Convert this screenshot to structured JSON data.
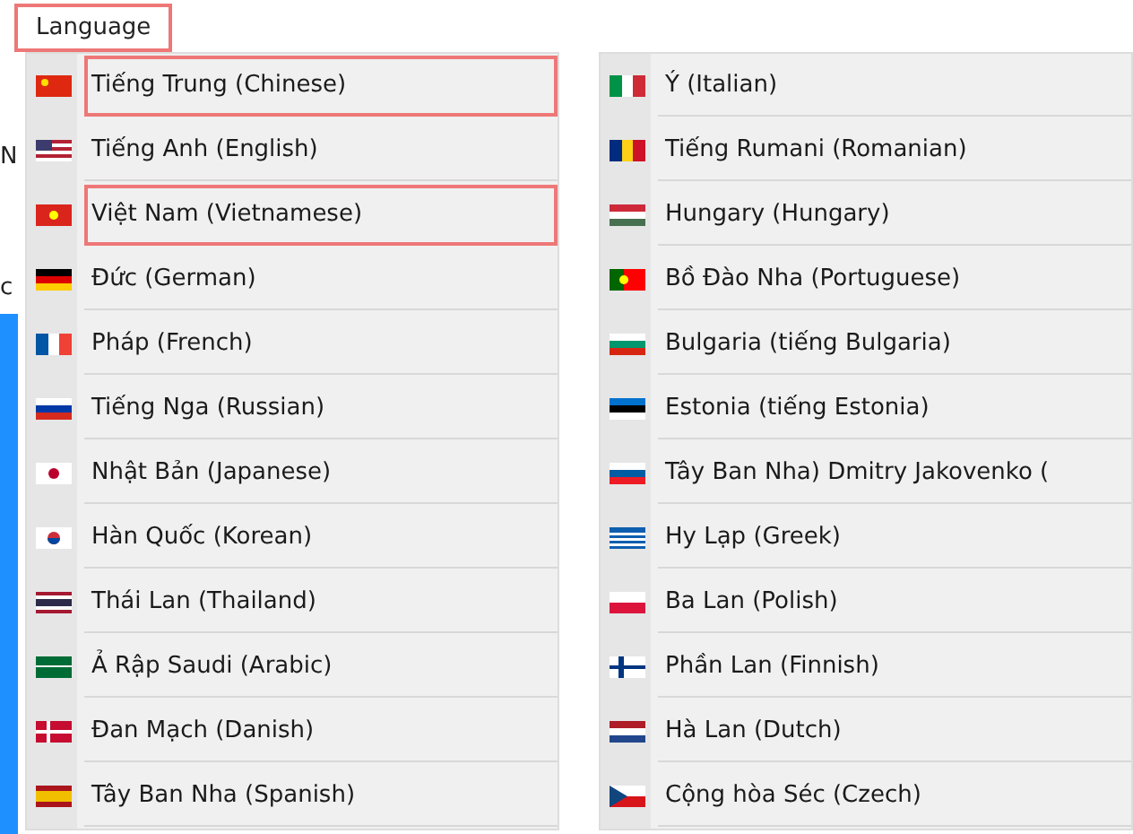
{
  "menu_title": "Language",
  "background_fragments": [
    "N",
    "c"
  ],
  "columns": [
    [
      {
        "label": "Tiếng Trung (Chinese)",
        "kind": "cn",
        "highlighted": true
      },
      {
        "label": "Tiếng Anh (English)",
        "kind": "us",
        "highlighted": false
      },
      {
        "label": "Việt Nam (Vietnamese)",
        "kind": "vn",
        "highlighted": true
      },
      {
        "label": "Đức (German)",
        "kind": "de",
        "highlighted": false
      },
      {
        "label": "Pháp (French)",
        "kind": "fr",
        "highlighted": false
      },
      {
        "label": "Tiếng Nga (Russian)",
        "kind": "ru",
        "highlighted": false
      },
      {
        "label": "Nhật Bản (Japanese)",
        "kind": "jp",
        "highlighted": false
      },
      {
        "label": "Hàn Quốc (Korean)",
        "kind": "kr",
        "highlighted": false
      },
      {
        "label": "Thái Lan (Thailand)",
        "kind": "th",
        "highlighted": false
      },
      {
        "label": "Ả Rập Saudi (Arabic)",
        "kind": "sa",
        "highlighted": false
      },
      {
        "label": "Đan Mạch (Danish)",
        "kind": "dk",
        "highlighted": false
      },
      {
        "label": "Tây Ban Nha (Spanish)",
        "kind": "es",
        "highlighted": false
      }
    ],
    [
      {
        "label": "Ý (Italian)",
        "kind": "it",
        "highlighted": false
      },
      {
        "label": "Tiếng Rumani (Romanian)",
        "kind": "ro",
        "highlighted": false
      },
      {
        "label": "Hungary (Hungary)",
        "kind": "hu",
        "highlighted": false
      },
      {
        "label": "Bồ Đào Nha (Portuguese)",
        "kind": "pt",
        "highlighted": false
      },
      {
        "label": "Bulgaria (tiếng Bulgaria)",
        "kind": "bg",
        "highlighted": false
      },
      {
        "label": "Estonia (tiếng Estonia)",
        "kind": "ee",
        "highlighted": false
      },
      {
        "label": "Tây Ban Nha) Dmitry Jakovenko (",
        "kind": "si",
        "highlighted": false
      },
      {
        "label": "Hy Lạp (Greek)",
        "kind": "gr",
        "highlighted": false
      },
      {
        "label": "Ba Lan (Polish)",
        "kind": "pl",
        "highlighted": false
      },
      {
        "label": "Phần Lan (Finnish)",
        "kind": "fi",
        "highlighted": false
      },
      {
        "label": "Hà Lan (Dutch)",
        "kind": "nl",
        "highlighted": false
      },
      {
        "label": "Cộng hòa Séc (Czech)",
        "kind": "cz",
        "highlighted": false
      }
    ]
  ]
}
